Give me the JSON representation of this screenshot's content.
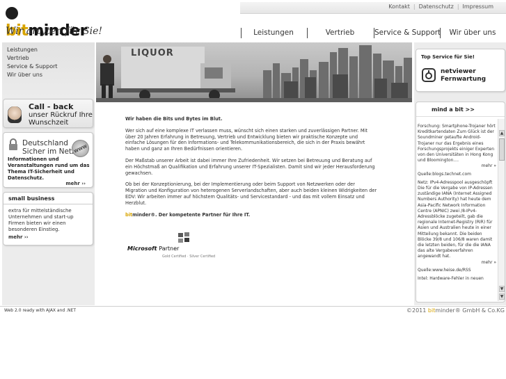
{
  "brand": {
    "logo_prefix": "bit",
    "logo_suffix": "minder",
    "tagline": "Wir artyten für Sie!",
    "accent_color": "#d8a400"
  },
  "toplinks": [
    "Kontakt",
    "Datenschutz",
    "Impressum"
  ],
  "mainnav": [
    "Leistungen",
    "Vertrieb",
    "Service & Support",
    "Wir über uns"
  ],
  "sidebar": {
    "links": [
      "Leistungen",
      "Vertrieb",
      "Service & Support",
      "Wir über uns"
    ]
  },
  "callback": {
    "title": "Call - back",
    "subtitle": "unser Rückruf Ihre Wunschzeit"
  },
  "deutschland": {
    "title": "Deutschland Sicher im Netz",
    "badge": "WWW",
    "text": "Informationen und Veranstaltungen rund um das Thema IT-Sicherheit und Datenschutz.",
    "more": "mehr ››"
  },
  "smallbusiness": {
    "title": "small business",
    "text": "extra für mittelständische Unternehmen und start-up Firmen bieten wir einen besonderen Einstieg.",
    "more": "mehr ››"
  },
  "hero": {
    "sign": "LIQUOR"
  },
  "content": {
    "lead": "Wir haben die Bits und Bytes im Blut.",
    "p1": "Wer sich auf eine komplexe IT verlassen muss, wünscht sich einen starken und zuverlässigen Partner. Mit über 20 Jahren Erfahrung in Betreuung, Vertrieb und Entwicklung bieten wir praktische Konzepte und einfache Lösungen für den Informations- und Telekommunikationsbereich, die sich in der Praxis bewährt haben und ganz an Ihren Bedürfnissen orientieren.",
    "p2": "Der Maßstab unserer Arbeit ist dabei immer Ihre Zufriedenheit. Wir setzen bei Betreuung und Beratung auf ein Höchstmaß an Qualifikation und Erfahrung unserer IT-Spezialisten. Damit sind wir jeder Herausforderung gewachsen.",
    "p3": "Ob bei der Konzeptionierung, bei der Implementierung oder beim Support von Netzwerken oder der Migration und Konfiguration von heterogenen Serverlandschaften, aber auch beiden kleinen Widrigkeiten der EDV: Wir arbeiten immer auf höchstem Qualitäts- und Servicestandard - und das mit vollem Einsatz und Herzblut.",
    "kompetent_bit": "bit",
    "kompetent_rest": "minder®. Der kompetente Partner für Ihre IT."
  },
  "mspartner": {
    "brand": "Microsoft",
    "label": "Partner",
    "sub": "Gold Certified · Silver Certified"
  },
  "topservice": {
    "title": "Top Service für Sie!",
    "label": "netviewer Fernwartung"
  },
  "mindabit": {
    "title": "mind a bit  >>",
    "news": [
      {
        "text": "Forschung: Smartphone-Trojaner hört Kreditkartendaten Zum Glück ist der Soundminer getaufte Android-Trojaner nur das Ergebnis eines Forschungsprojekts einiger Experten von den Universitäten in Hong Kong und Bloomington....",
        "more": "mehr »",
        "source": "Quelle:blogs.technet.com"
      },
      {
        "text": "Netz: IPv4-Adresspool ausgeschöpft Die für die Vergabe von IP-Adressen zuständige IANA (Internet Assigned Numbers Authority) hat heute dem Asia-Pacific Network Information Centre (APNIC) zwei /8-IPv4-Adressblöcke zugeteilt, gab die regionale Internet-Registry (RIR) für Asien und Australien heute in einer Mitteilung bekannt. Die beiden Blöcke 39/8 und 106/8 waren damit die letzten beiden, für die die IANA das alte Vergabeverfahren angewandt hat.",
        "more": "mehr »",
        "source": "Quelle:www.heise.de/RSS"
      },
      {
        "text": "Intel: Hardware-Fehler in neuen",
        "more": "",
        "source": ""
      }
    ]
  },
  "footer": {
    "left": "Web 2.0 ready with AJAX and .NET",
    "right_prefix": "©2011 ",
    "right_bit": "bit",
    "right_rest": "minder® GmbH & Co.KG"
  }
}
